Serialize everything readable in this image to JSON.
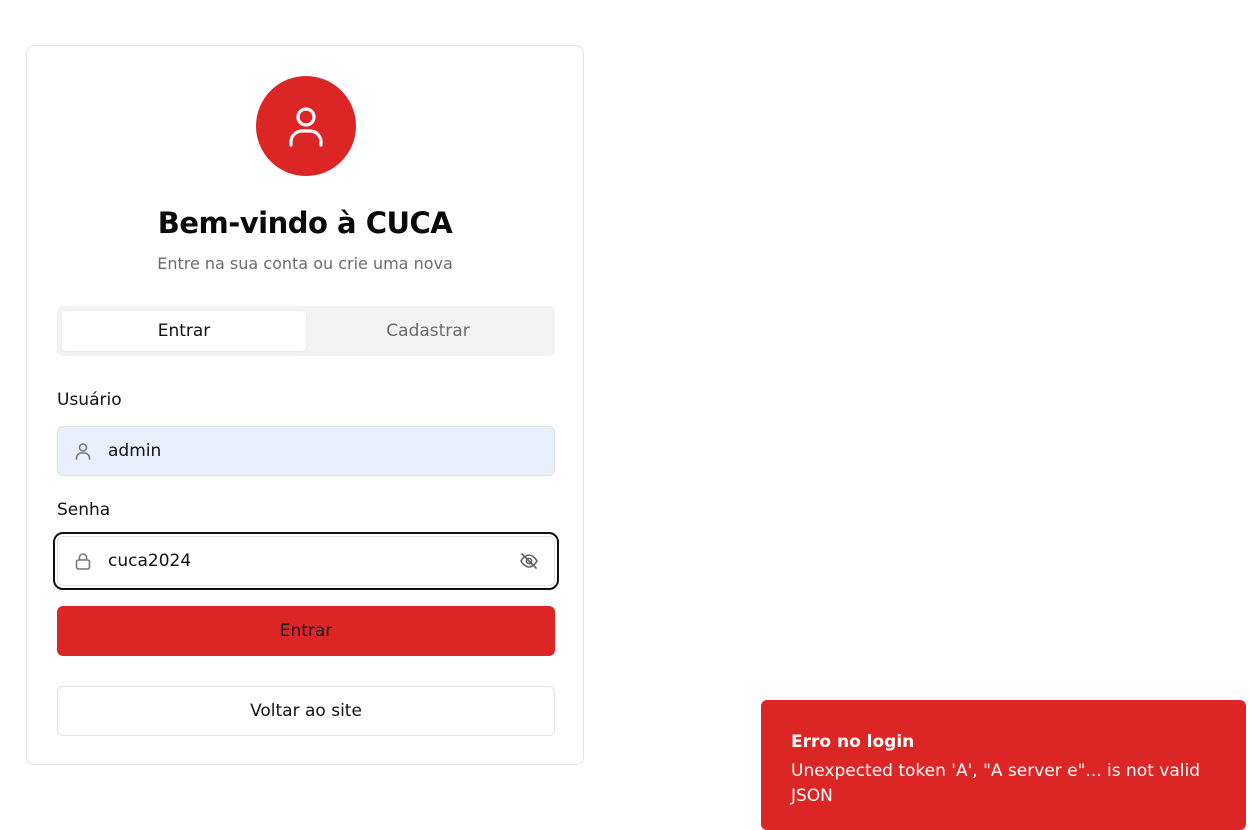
{
  "header": {
    "title": "Bem-vindo à CUCA",
    "subtitle": "Entre na sua conta ou crie uma nova"
  },
  "tabs": [
    {
      "label": "Entrar",
      "active": true
    },
    {
      "label": "Cadastrar",
      "active": false
    }
  ],
  "form": {
    "username_label": "Usuário",
    "username_value": "admin",
    "password_label": "Senha",
    "password_value": "cuca2024",
    "submit_label": "Entrar",
    "back_label": "Voltar ao site"
  },
  "toast": {
    "title": "Erro no login",
    "message": "Unexpected token 'A', \"A server e\"... is not valid JSON"
  },
  "colors": {
    "brand": "#dc2626",
    "autofill": "#e8f0fe"
  },
  "icons": {
    "avatar": "user-icon",
    "username": "user-icon",
    "password": "lock-icon",
    "visibility": "eye-off-icon"
  }
}
